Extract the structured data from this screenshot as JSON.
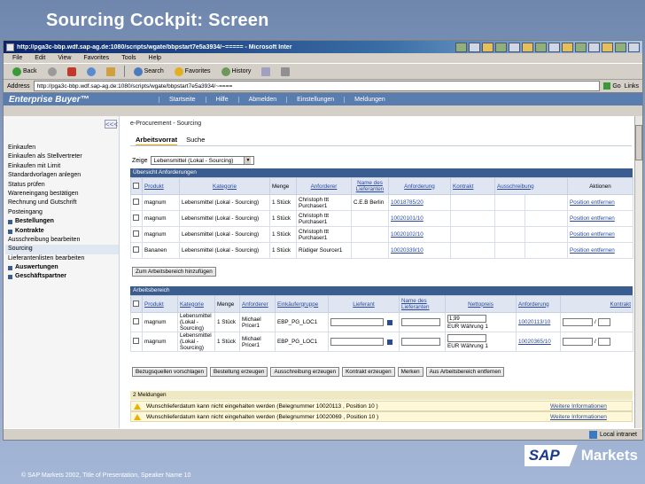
{
  "slide": {
    "title": "Sourcing Cockpit: Screen",
    "footer": "© SAP Markets 2002, Title of Presentation, Speaker Name 10",
    "logo_left": "SAP",
    "logo_right": "Markets"
  },
  "browser": {
    "window_title": "http://pga3c-bbp.wdf.sap-ag.de:1080/scripts/wgate/bbpstart7e5a3934/~===== - Microsoft Inter",
    "menu": [
      "File",
      "Edit",
      "View",
      "Favorites",
      "Tools",
      "Help"
    ],
    "toolbar": {
      "back": "Back",
      "search": "Search",
      "favorites": "Favorites",
      "history": "History"
    },
    "address_label": "Address",
    "address_value": "http://pga3c-bbp.wdf.sap-ag.de:1080/scripts/wgate/bbpstart7e5a3934/~====",
    "go": "Go",
    "links": "Links",
    "status_zone": "Local intranet"
  },
  "app": {
    "brand": "Enterprise Buyer™",
    "nav": [
      "Startseite",
      "Hilfe",
      "Abmelden",
      "Einstellungen",
      "Meldungen"
    ],
    "collapse": "<<<"
  },
  "sidebar": {
    "items": [
      {
        "label": "Einkaufen",
        "bold": false
      },
      {
        "label": "Einkaufen als Stellvertreter",
        "bold": false
      },
      {
        "label": "Einkaufen mit Limit",
        "bold": false
      },
      {
        "label": "Standardvorlagen anlegen",
        "bold": false
      },
      {
        "label": "Status prüfen",
        "bold": false
      },
      {
        "label": "Wareneingang bestätigen",
        "bold": false
      },
      {
        "label": "Rechnung und Gutschrift",
        "bold": false
      },
      {
        "label": "Posteingang",
        "bold": false
      },
      {
        "label": "Bestellungen",
        "bold": true
      },
      {
        "label": "Kontrakte",
        "bold": true
      },
      {
        "label": "Ausschreibung bearbeiten",
        "bold": false
      },
      {
        "label": "Sourcing",
        "bold": false,
        "selected": true
      },
      {
        "label": "Lieferantenlisten bearbeiten",
        "bold": false
      },
      {
        "label": "Auswertungen",
        "bold": true
      },
      {
        "label": "Geschäftspartner",
        "bold": true
      }
    ]
  },
  "main": {
    "breadcrumb": "e-Procurement - Sourcing",
    "tabs": [
      "Arbeitsvorrat",
      "Suche"
    ],
    "zeige_label": "Zeige",
    "zeige_value": "Lebensmittel (Lokal - Sourcing)",
    "overview": {
      "title": "Übersicht Anforderungen",
      "headers": [
        "Produkt",
        "Kategorie",
        "Menge",
        "Anforderer",
        "Name des Lieferanten",
        "Anforderung",
        "Kontrakt",
        "Ausschreibung",
        "Aktionen"
      ],
      "rows": [
        {
          "produkt": "magnum",
          "kategorie": "Lebensmittel (Lokal - Sourcing)",
          "menge": "1 Stück",
          "anforderer": "Christoph ttt Purchaser1",
          "lieferant": "C.E.B Berlin",
          "anforderung": "10018785/20",
          "kontrakt": "",
          "ausschreibung": "",
          "aktion": "Position entfernen"
        },
        {
          "produkt": "magnum",
          "kategorie": "Lebensmittel (Lokal - Sourcing)",
          "menge": "1 Stück",
          "anforderer": "Christoph ttt Purchaser1",
          "lieferant": "",
          "anforderung": "10020101/10",
          "kontrakt": "",
          "ausschreibung": "",
          "aktion": "Position entfernen"
        },
        {
          "produkt": "magnum",
          "kategorie": "Lebensmittel (Lokal - Sourcing)",
          "menge": "1 Stück",
          "anforderer": "Christoph ttt Purchaser1",
          "lieferant": "",
          "anforderung": "10020102/10",
          "kontrakt": "",
          "ausschreibung": "",
          "aktion": "Position entfernen"
        },
        {
          "produkt": "Bananen",
          "kategorie": "Lebensmittel (Lokal - Sourcing)",
          "menge": "1 Stück",
          "anforderer": "Rüdiger Sourcer1",
          "lieferant": "",
          "anforderung": "10020339/10",
          "kontrakt": "",
          "ausschreibung": "",
          "aktion": "Position entfernen"
        }
      ],
      "add_button": "Zum Arbeitsbereich hinzufügen"
    },
    "workspace": {
      "title": "Arbeitsbereich",
      "headers": [
        "Produkt",
        "Kategorie",
        "Menge",
        "Anforderer",
        "Einkäufergruppe",
        "Lieferant",
        "Name des Lieferanten",
        "Nettopreis",
        "Anforderung",
        "Kontrakt"
      ],
      "rows": [
        {
          "produkt": "magnum",
          "kategorie": "Lebensmittel (Lokal - Sourcing)",
          "menge": "1 Stück",
          "anforderer": "Michael Pricer1",
          "gruppe": "EBP_PG_LOC1",
          "lieferant": "",
          "preis": "1,99",
          "waehrung": "EUR Währung 1",
          "anforderung": "10020113/10",
          "kontrakt": "/"
        },
        {
          "produkt": "magnum",
          "kategorie": "Lebensmittel (Lokal - Sourcing)",
          "menge": "1 Stück",
          "anforderer": "Michael Pricer1",
          "gruppe": "EBP_PG_LOC1",
          "lieferant": "",
          "preis": "",
          "waehrung": "EUR Währung 1",
          "anforderung": "10020365/10",
          "kontrakt": "/"
        }
      ],
      "buttons": [
        "Bezugsquellen vorschlagen",
        "Bestellung erzeugen",
        "Ausschreibung erzeugen",
        "Kontrakt erzeugen",
        "Merken",
        "Aus Arbeitsbereich entfernen"
      ]
    },
    "messages": {
      "title": "2 Meldungen",
      "rows": [
        {
          "text": "Wunschlieferdatum kann nicht eingehalten werden  (Belegnummer 10020113 , Position 10 )",
          "link": "Weitere Informationen"
        },
        {
          "text": "Wunschlieferdatum kann nicht eingehalten werden  (Belegnummer 10020069 , Position 10 )",
          "link": "Weitere Informationen"
        }
      ]
    }
  }
}
